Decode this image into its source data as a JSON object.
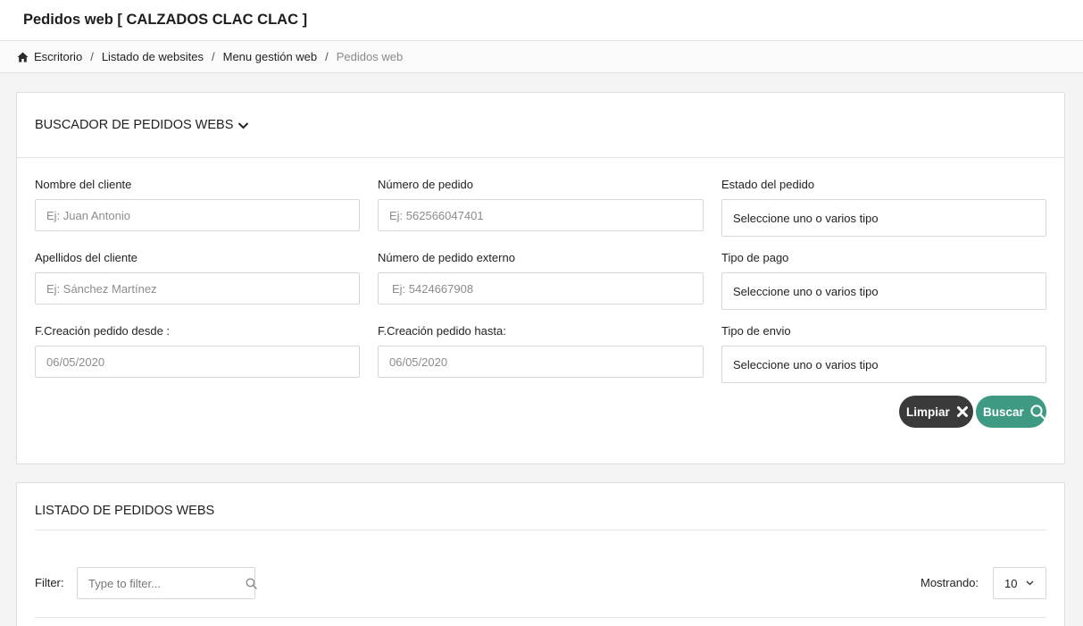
{
  "header": {
    "title": "Pedidos web [ CALZADOS CLAC CLAC ]"
  },
  "breadcrumb": {
    "items": [
      "Escritorio",
      "Listado de websites",
      "Menu gestión web"
    ],
    "current": "Pedidos web",
    "separator": "/"
  },
  "search": {
    "title": "BUSCADOR DE PEDIDOS WEBS",
    "fields": {
      "client_name": {
        "label": "Nombre del cliente",
        "placeholder": "Ej: Juan Antonio"
      },
      "order_number": {
        "label": "Número de pedido",
        "placeholder": "Ej: 562566047401"
      },
      "order_status": {
        "label": "Estado del pedido",
        "value": "Seleccione uno o varios tipo"
      },
      "client_surname": {
        "label": "Apellidos del cliente",
        "placeholder": "Ej: Sánchez Martínez"
      },
      "external_order_number": {
        "label": "Número de pedido externo",
        "placeholder": "Ej: 5424667908"
      },
      "payment_type": {
        "label": "Tipo de pago",
        "value": "Seleccione uno o varios tipo"
      },
      "date_from": {
        "label": "F.Creación pedido desde :",
        "value": "06/05/2020"
      },
      "date_to": {
        "label": "F.Creación pedido hasta:",
        "value": "06/05/2020"
      },
      "shipping_type": {
        "label": "Tipo de envio",
        "value": "Seleccione uno o varios tipo"
      }
    },
    "clear_label": "Limpiar",
    "search_label": "Buscar"
  },
  "list": {
    "title": "LISTADO DE PEDIDOS WEBS",
    "filter_label": "Filter:",
    "filter_placeholder": "Type to filter...",
    "showing_label": "Mostrando:",
    "page_size": "10"
  },
  "colors": {
    "buscar": "#3f9a84",
    "limpiar": "#3a3a3a"
  },
  "icons": [
    "home-icon",
    "chevron-down-icon",
    "close-icon",
    "search-icon"
  ]
}
